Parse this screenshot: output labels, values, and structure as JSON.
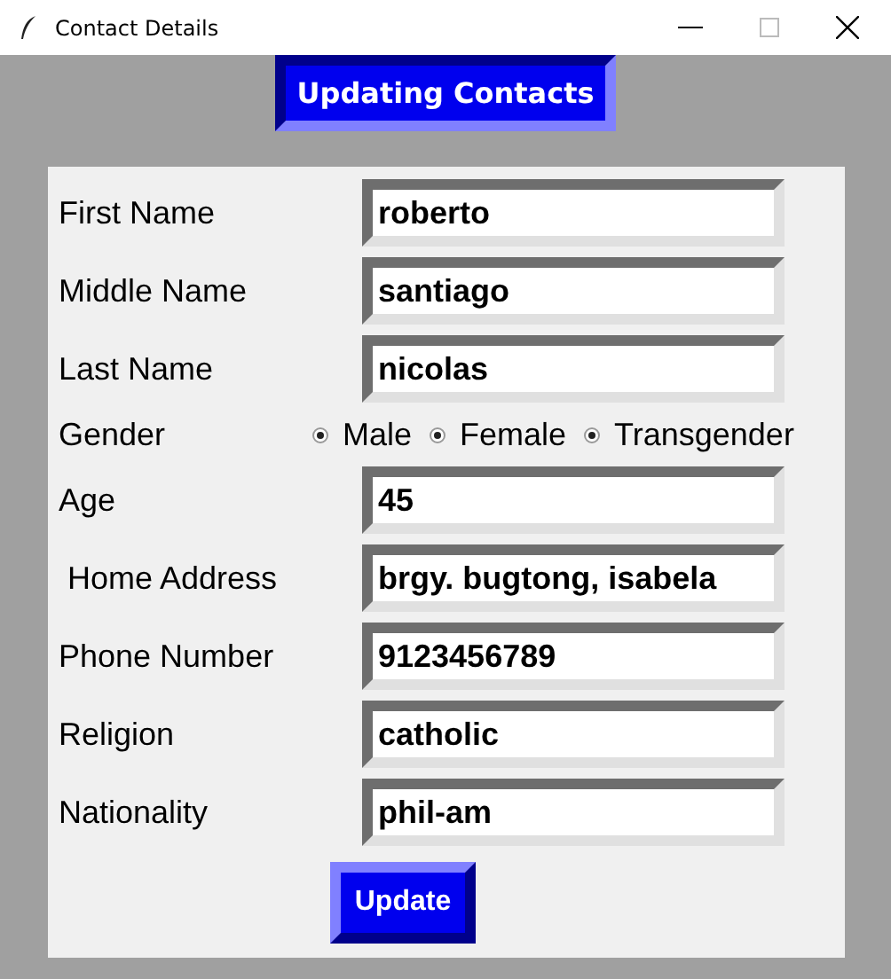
{
  "window": {
    "title": "Contact Details"
  },
  "header": "Updating Contacts",
  "fields": [
    {
      "kind": "entry",
      "label": "First Name",
      "value": "roberto"
    },
    {
      "kind": "entry",
      "label": "Middle Name",
      "value": "santiago"
    },
    {
      "kind": "entry",
      "label": "Last Name",
      "value": "nicolas"
    },
    {
      "kind": "radio",
      "label": "Gender",
      "options": [
        {
          "label": "Male",
          "selected": true
        },
        {
          "label": "Female",
          "selected": true
        },
        {
          "label": "Transgender",
          "selected": true
        }
      ]
    },
    {
      "kind": "entry",
      "label": "Age",
      "value": "45"
    },
    {
      "kind": "entry",
      "label": " Home Address",
      "value": "brgy. bugtong, isabela"
    },
    {
      "kind": "entry",
      "label": "Phone Number",
      "value": "9123456789"
    },
    {
      "kind": "entry",
      "label": "Religion",
      "value": "catholic"
    },
    {
      "kind": "entry",
      "label": "Nationality",
      "value": "phil-am"
    }
  ],
  "button": "Update"
}
